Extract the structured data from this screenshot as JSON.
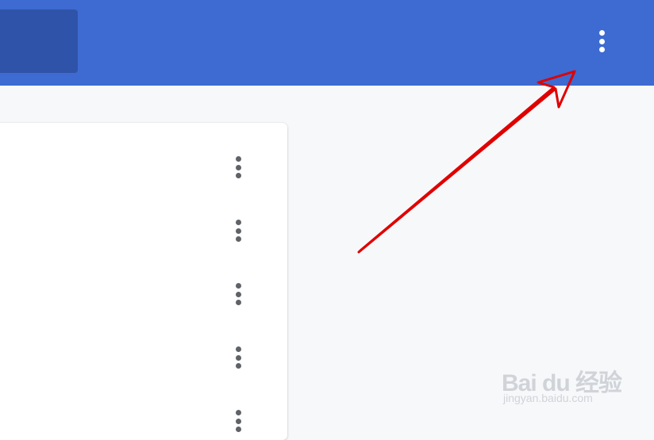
{
  "header": {
    "menu_icon": "more-vert-icon",
    "background_color": "#3d6bd1",
    "search_box_color": "#2f53a8"
  },
  "list": {
    "rows": [
      {
        "menu_icon": "more-vert-icon"
      },
      {
        "menu_icon": "more-vert-icon"
      },
      {
        "menu_icon": "more-vert-icon"
      },
      {
        "menu_icon": "more-vert-icon"
      },
      {
        "menu_icon": "more-vert-icon"
      }
    ]
  },
  "annotation": {
    "type": "red-arrow",
    "color": "#e00000",
    "points_to": "header-menu-button"
  },
  "watermark": {
    "logo_text": "Bai du 经验",
    "url_text": "jingyan.baidu.com"
  }
}
